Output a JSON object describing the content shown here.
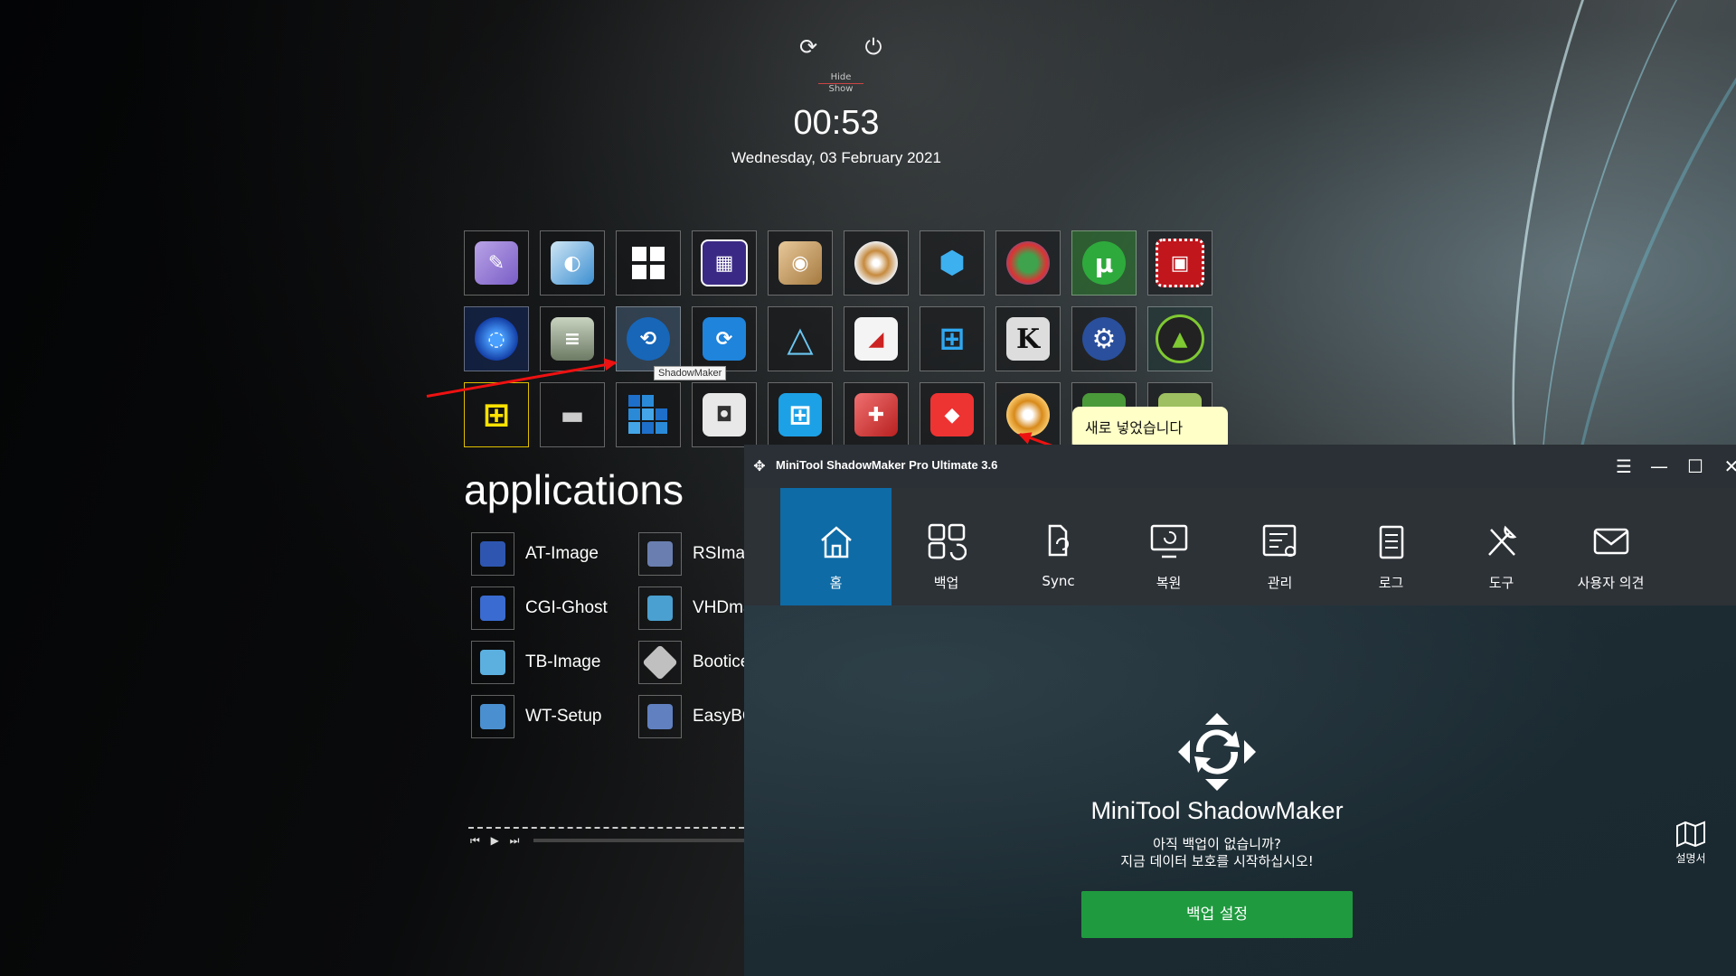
{
  "lockscreen": {
    "hide_label": "Hide",
    "show_label": "Show",
    "time": "00:53",
    "date": "Wednesday, 03  February  2021"
  },
  "tiles": {
    "tooltip": "ShadowMaker",
    "note": "새로 넣었습니다"
  },
  "applications": {
    "title": "applications",
    "items": [
      {
        "label": "AT-Image",
        "color": "#2e56b0"
      },
      {
        "label": "RSImag",
        "color": "#6a7fb0"
      },
      {
        "label": "CGI-Ghost",
        "color": "#3a6bd0"
      },
      {
        "label": "VHDma",
        "color": "#4aa0d0"
      },
      {
        "label": "TB-Image",
        "color": "#5bb0e0"
      },
      {
        "label": "Bootice",
        "color": "#c0c0c0"
      },
      {
        "label": "WT-Setup",
        "color": "#4a90d0"
      },
      {
        "label": "EasyBC",
        "color": "#6080c0"
      }
    ],
    "media_controls": "⏮ ▶ ⏭"
  },
  "minitool": {
    "title": "MiniTool ShadowMaker Pro Ultimate 3.6",
    "nav": [
      {
        "label": "홈",
        "icon": "home-icon"
      },
      {
        "label": "백업",
        "icon": "backup-grid-icon"
      },
      {
        "label": "Sync",
        "icon": "sync-icon"
      },
      {
        "label": "복원",
        "icon": "restore-icon"
      },
      {
        "label": "관리",
        "icon": "manage-icon"
      },
      {
        "label": "로그",
        "icon": "log-icon"
      },
      {
        "label": "도구",
        "icon": "tools-icon"
      },
      {
        "label": "사용자 의견",
        "icon": "feedback-icon"
      }
    ],
    "hero_title": "MiniTool ShadowMaker",
    "hero_sub1": "아직 백업이 없습니까?",
    "hero_sub2": "지금 데이터 보호를 시작하십시오!",
    "cta": "백업 설정",
    "manual": "설명서",
    "accent": "#0e6ba6",
    "cta_color": "#1f9a3f"
  }
}
